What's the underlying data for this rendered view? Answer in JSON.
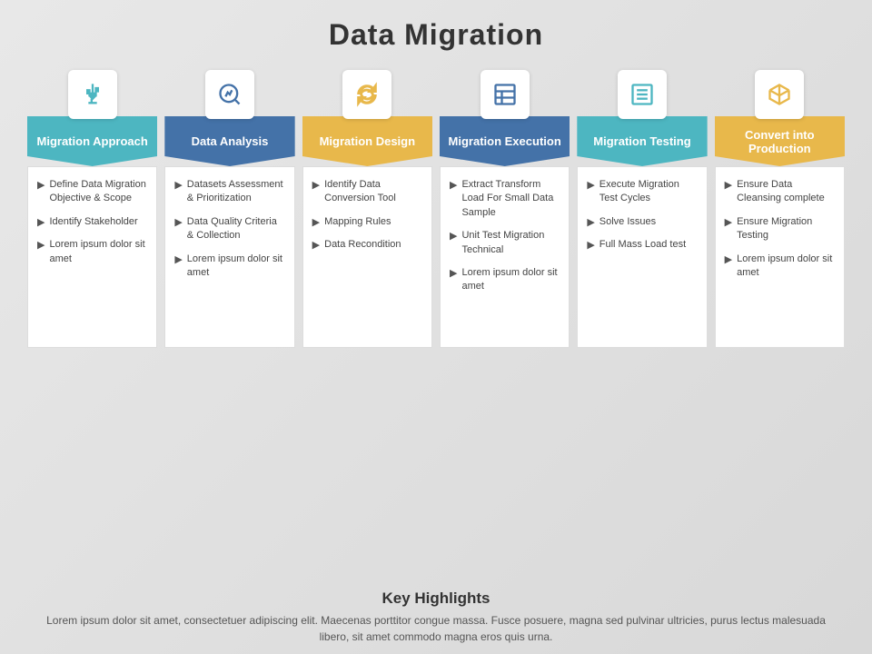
{
  "title": "Data Migration",
  "columns": [
    {
      "id": "migration-approach",
      "header": "Migration Approach",
      "headerColor": "#4db6c1",
      "iconType": "usb",
      "iconColor": "#4db6c1",
      "items": [
        "Define Data Migration Objective & Scope",
        "Identify Stakeholder",
        "Lorem ipsum dolor sit amet"
      ]
    },
    {
      "id": "data-analysis",
      "header": "Data Analysis",
      "headerColor": "#4472a8",
      "iconType": "search-chart",
      "iconColor": "#4472a8",
      "items": [
        "Datasets Assessment & Prioritization",
        "Data Quality Criteria & Collection",
        "Lorem ipsum dolor sit amet"
      ]
    },
    {
      "id": "migration-design",
      "header": "Migration Design",
      "headerColor": "#e8b84b",
      "iconType": "refresh",
      "iconColor": "#e8b84b",
      "items": [
        "Identify Data Conversion Tool",
        "Mapping Rules",
        "Data Recondition"
      ]
    },
    {
      "id": "migration-execution",
      "header": "Migration Execution",
      "headerColor": "#4472a8",
      "iconType": "table",
      "iconColor": "#4472a8",
      "items": [
        "Extract Transform Load For Small Data Sample",
        "Unit Test Migration Technical",
        "Lorem ipsum dolor sit amet"
      ]
    },
    {
      "id": "migration-testing",
      "header": "Migration Testing",
      "headerColor": "#4db6c1",
      "iconType": "list",
      "iconColor": "#4db6c1",
      "items": [
        "Execute Migration Test Cycles",
        "Solve Issues",
        "Full Mass Load test"
      ]
    },
    {
      "id": "convert-production",
      "header": "Convert into Production",
      "headerColor": "#e8b84b",
      "iconType": "box",
      "iconColor": "#e8b84b",
      "items": [
        "Ensure Data Cleansing complete",
        "Ensure Migration Testing",
        "Lorem ipsum dolor sit amet"
      ]
    }
  ],
  "keyHighlights": {
    "title": "Key Highlights",
    "text": "Lorem ipsum dolor sit amet, consectetuer adipiscing elit. Maecenas porttitor congue massa. Fusce posuere, magna sed pulvinar ultricies, purus lectus malesuada libero, sit amet commodo magna eros quis urna."
  }
}
